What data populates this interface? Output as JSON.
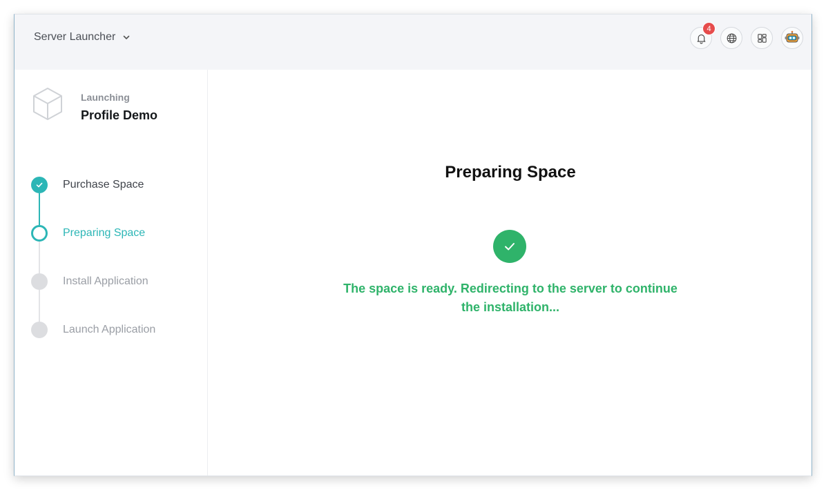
{
  "header": {
    "app_name": "Server Launcher",
    "notifications_count": "4",
    "icons": [
      "chevron-down-icon",
      "bell-icon",
      "globe-icon",
      "apps-grid-icon",
      "robot-avatar-icon"
    ]
  },
  "sidebar": {
    "project_label": "Launching",
    "project_name": "Profile Demo",
    "steps": [
      {
        "label": "Purchase Space",
        "state": "done"
      },
      {
        "label": "Preparing Space",
        "state": "active"
      },
      {
        "label": "Install Application",
        "state": "pending"
      },
      {
        "label": "Launch Application",
        "state": "pending"
      }
    ]
  },
  "main": {
    "title": "Preparing Space",
    "status_message": "The space is ready. Redirecting to the server to continue the installation..."
  },
  "colors": {
    "accent_teal": "#2cb6b6",
    "success_green": "#2fb36a",
    "badge_red": "#e64c4c",
    "pending_gray": "#dcdde0",
    "topbar_bg": "#f4f5f8"
  }
}
